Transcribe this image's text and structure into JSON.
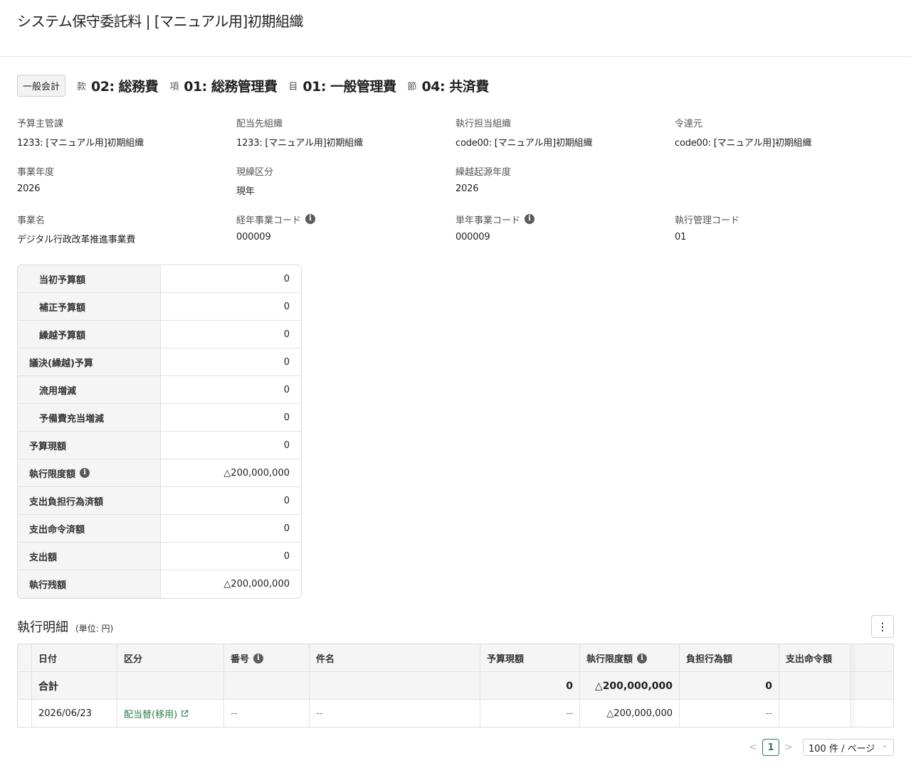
{
  "header": {
    "title": "システム保守委託料 | [マニュアル用]初期組織"
  },
  "classification": {
    "account": "一般会計",
    "items": [
      {
        "label": "款",
        "value": "02: 総務費"
      },
      {
        "label": "項",
        "value": "01: 総務管理費"
      },
      {
        "label": "目",
        "value": "01: 一般管理費"
      },
      {
        "label": "節",
        "value": "04: 共済費"
      }
    ]
  },
  "info": {
    "rows": [
      [
        {
          "label": "予算主管課",
          "value": "1233: [マニュアル用]初期組織",
          "icon": ""
        },
        {
          "label": "配当先組織",
          "value": "1233: [マニュアル用]初期組織",
          "icon": ""
        },
        {
          "label": "執行担当組織",
          "value": "code00: [マニュアル用]初期組織",
          "icon": ""
        },
        {
          "label": "令達元",
          "value": "code00: [マニュアル用]初期組織",
          "icon": ""
        }
      ],
      [
        {
          "label": "事業年度",
          "value": "2026",
          "icon": ""
        },
        {
          "label": "現繰区分",
          "value": "現年",
          "icon": ""
        },
        {
          "label": "繰越起源年度",
          "value": "2026",
          "icon": ""
        },
        {
          "label": "",
          "value": "",
          "icon": ""
        }
      ],
      [
        {
          "label": "事業名",
          "value": "デジタル行政改革推進事業費",
          "icon": ""
        },
        {
          "label": "経年事業コード",
          "value": "000009",
          "icon": "info-icon"
        },
        {
          "label": "単年事業コード",
          "value": "000009",
          "icon": "info-icon"
        },
        {
          "label": "執行管理コード",
          "value": "01",
          "icon": ""
        }
      ]
    ]
  },
  "budget": {
    "rows": [
      {
        "label": "当初予算額",
        "value": "0"
      },
      {
        "label": "補正予算額",
        "value": "0"
      },
      {
        "label": "繰越予算額",
        "value": "0"
      },
      {
        "label": "議決(繰越)予算",
        "value": "0"
      },
      {
        "label": "流用増減",
        "value": "0"
      },
      {
        "label": "予備費充当増減",
        "value": "0"
      },
      {
        "label": "予算現額",
        "value": "0"
      },
      {
        "label": "執行限度額",
        "value": "△200,000,000"
      },
      {
        "label": "支出負担行為済額",
        "value": "0"
      },
      {
        "label": "支出命令済額",
        "value": "0"
      },
      {
        "label": "支出額",
        "value": "0"
      },
      {
        "label": "執行残額",
        "value": "△200,000,000"
      }
    ]
  },
  "details": {
    "title": "執行明細",
    "unit": "(単位: 円)",
    "columns": [
      "日付",
      "区分",
      "番号",
      "件名",
      "予算現額",
      "執行限度額",
      "負担行為額",
      "支出命令額"
    ],
    "total": {
      "label": "合計",
      "budget": "0",
      "limit": "△200,000,000",
      "commitment": "0"
    },
    "rows": [
      {
        "date": "2026/06/23",
        "category": "配当替(移用)",
        "number": "--",
        "subject": "--",
        "budget": "--",
        "limit": "△200,000,000",
        "commitment": "--",
        "order": ""
      }
    ]
  },
  "pagination": {
    "prev": "<",
    "current": "1",
    "next": ">",
    "page_size": "100 件 / ページ"
  },
  "menu": {
    "kebab": "⋮"
  }
}
